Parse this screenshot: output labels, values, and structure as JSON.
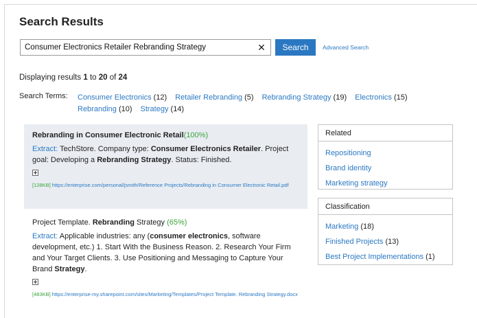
{
  "header": {
    "title": "Search Results"
  },
  "search": {
    "query": "Consumer Electronics Retailer Rebranding Strategy",
    "clear_glyph": "✕",
    "button_label": "Search",
    "advanced_label": "Advanced Search"
  },
  "results_info": {
    "prefix": "Displaying results",
    "start": "1",
    "to": "to",
    "end": "20",
    "of": "of",
    "total": "24"
  },
  "search_terms": {
    "label": "Search Terms:",
    "items": [
      {
        "label": "Consumer Electronics",
        "count": "(12)"
      },
      {
        "label": "Retailer Rebranding",
        "count": "(5)"
      },
      {
        "label": "Rebranding Strategy",
        "count": "(19)"
      },
      {
        "label": "Electronics",
        "count": "(15)"
      },
      {
        "label": "Rebranding",
        "count": "(10)"
      },
      {
        "label": "Strategy",
        "count": "(14)"
      }
    ]
  },
  "results": [
    {
      "title": "Rebranding in Consumer Electronic Retail",
      "score": "(100%)",
      "extract_label": "Extract:",
      "extract_parts": [
        "TechStore. Company type: ",
        "Consumer Electronics Retailer",
        ". Project goal: Developing a ",
        "Rebranding Strategy",
        ". Status: Finished."
      ],
      "size": "[128KB]",
      "url": "https://enterprise.com/personal/jsmith/Reference Projects/Rebranding in Consumer Electronic Retail.pdf"
    },
    {
      "title_prefix": "Project Template. ",
      "title_bold": "Rebranding",
      "title_suffix": " Strategy",
      "score": "(65%)",
      "extract_label": "Extract:",
      "extract_parts": [
        "Applicable industries: any (",
        "consumer electronics",
        ", software development, etc.) 1. Start With the Business Reason. 2. Research Your Firm and Your Target Clients. 3. Use Positioning and Messaging to Capture Your Brand ",
        "Strategy",
        "."
      ],
      "size": "[483KB]",
      "url": "https://enterprise-my.sharepoint.com/sites/Marketing/Templates/Project Template. Rebranding Strategy.docx"
    }
  ],
  "related": {
    "heading": "Related",
    "items": [
      {
        "label": "Repositioning"
      },
      {
        "label": "Brand identity"
      },
      {
        "label": "Marketing strategy"
      }
    ]
  },
  "classification": {
    "heading": "Classification",
    "items": [
      {
        "label": "Marketing",
        "count": "(18)"
      },
      {
        "label": "Finished Projects",
        "count": "(13)"
      },
      {
        "label": "Best Project Implementations",
        "count": "(1)"
      }
    ]
  },
  "colors": {
    "accent": "#2b78c2",
    "score_green": "#3aa33a",
    "highlight_bg": "#e9edf2"
  }
}
